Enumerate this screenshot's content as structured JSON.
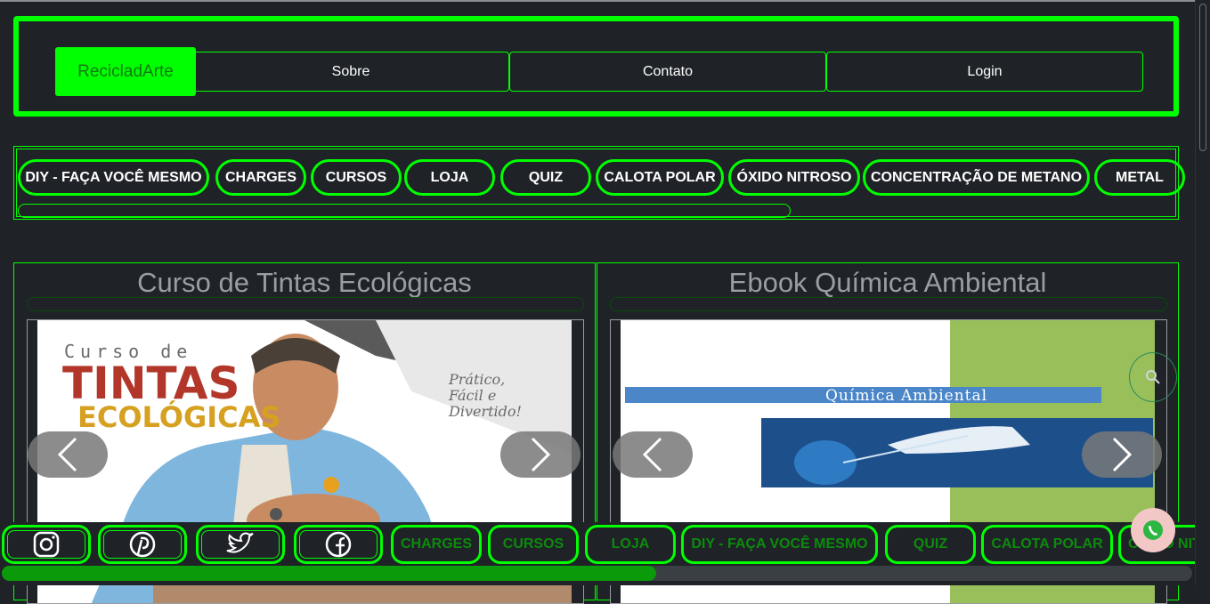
{
  "header": {
    "brand": "RecicladArte",
    "nav": [
      "Sobre",
      "Contato",
      "Login"
    ]
  },
  "categories": [
    "DIY - FAÇA VOCÊ MESMO",
    "CHARGES",
    "CURSOS",
    "LOJA",
    "QUIZ",
    "CALOTA POLAR",
    "ÓXIDO NITROSO",
    "CONCENTRAÇÃO DE METANO",
    "METAL"
  ],
  "cards": [
    {
      "title": "Curso de Tintas Ecológicas",
      "image_text": {
        "line1": "Curso de",
        "line2": "TINTAS",
        "line3": "ECOLÓGICAS",
        "tag1": "Prático,",
        "tag2": "Fácil e",
        "tag3": "Divertido!"
      }
    },
    {
      "title": "Ebook Química Ambiental",
      "image_text": {
        "banner": "Química Ambiental"
      }
    }
  ],
  "footer": {
    "icons": [
      "instagram-icon",
      "pinterest-icon",
      "twitter-icon",
      "facebook-icon"
    ],
    "links": [
      "CHARGES",
      "CURSOS",
      "LOJA",
      "DIY - FAÇA VOCÊ MESMO",
      "QUIZ",
      "CALOTA POLAR",
      "ÓXIDO NITROSO"
    ]
  },
  "colors": {
    "accent": "#00ff00",
    "background": "#1f2327",
    "title_gray": "#9a9ea3"
  }
}
